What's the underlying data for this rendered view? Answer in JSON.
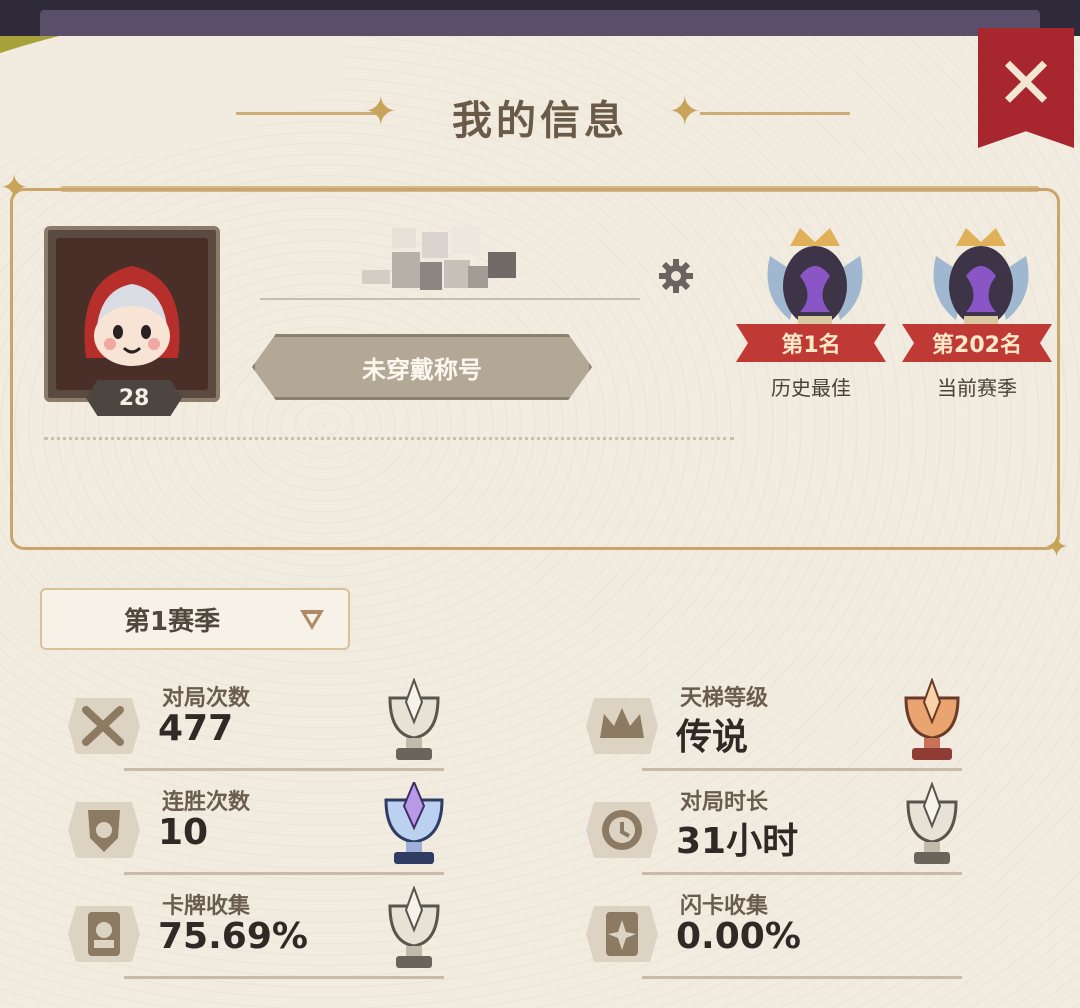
{
  "header": {
    "title": "我的信息",
    "close_icon": "close-icon"
  },
  "profile": {
    "level": "28",
    "name_blurred": true,
    "title_badge": "未穿戴称号",
    "settings_icon": "gear-icon"
  },
  "ranks": [
    {
      "ribbon": "第1名",
      "caption": "历史最佳"
    },
    {
      "ribbon": "第202名",
      "caption": "当前赛季"
    }
  ],
  "season": {
    "selected": "第1赛季"
  },
  "stats": [
    {
      "label": "对局次数",
      "value": "477",
      "icon": "crossed-swords-icon",
      "trophy": "silver"
    },
    {
      "label": "天梯等级",
      "value": "传说",
      "icon": "crown-icon",
      "trophy": "bronze"
    },
    {
      "label": "连胜次数",
      "value": "10",
      "icon": "streak-shield-icon",
      "trophy": "diamond"
    },
    {
      "label": "对局时长",
      "value": "31小时",
      "icon": "clock-icon",
      "trophy": "silver"
    },
    {
      "label": "卡牌收集",
      "value": "75.69%",
      "icon": "card-collection-icon",
      "trophy": "silver"
    },
    {
      "label": "闪卡收集",
      "value": "0.00%",
      "icon": "shiny-card-icon",
      "trophy": "silver"
    }
  ],
  "colors": {
    "accent_red": "#a8262d",
    "ribbon_red": "#c03a35",
    "gold": "#c9a46b",
    "text_dark": "#2f2a25"
  }
}
